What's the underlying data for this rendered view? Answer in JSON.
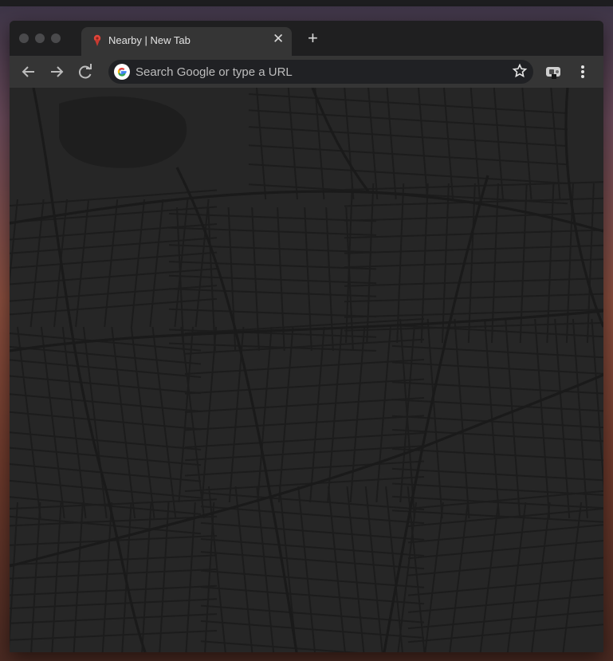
{
  "browser": {
    "tab": {
      "title": "Nearby | New Tab",
      "favicon": "map-pin-icon",
      "close_icon": "close-icon",
      "close_glyph": "✕"
    },
    "new_tab": {
      "icon": "plus-icon",
      "glyph": "+"
    },
    "toolbar": {
      "back_icon": "arrow-left-icon",
      "forward_icon": "arrow-right-icon",
      "reload_icon": "reload-icon",
      "omnibox": {
        "icon": "google-g-icon",
        "placeholder": "Search Google or type a URL"
      },
      "bookmark_icon": "star-icon",
      "extension_icon": "extension-icon",
      "menu_icon": "kebab-menu-icon"
    }
  },
  "page": {
    "background": "dark-street-map",
    "map_color": "#262626",
    "road_color": "#1b1b1b"
  }
}
